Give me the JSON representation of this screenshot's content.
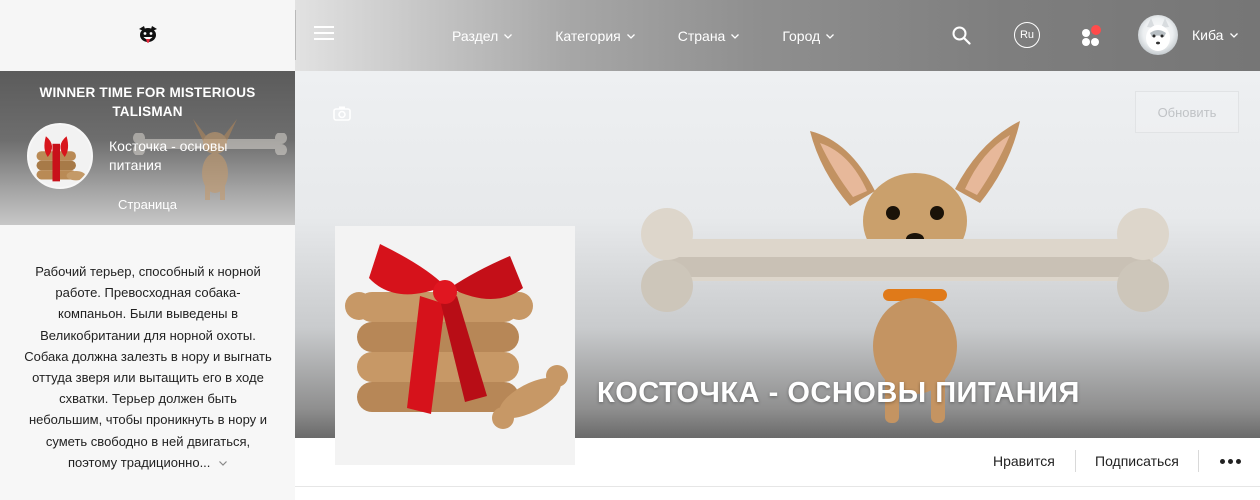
{
  "header": {
    "nav": [
      {
        "label": "Раздел"
      },
      {
        "label": "Категория"
      },
      {
        "label": "Страна"
      },
      {
        "label": "Город"
      }
    ],
    "lang": "Ru",
    "user_name": "Киба",
    "notification_color": "#ff4b4b"
  },
  "sidebar": {
    "card_title": "WINNER TIME FOR MISTERIOUS TALISMAN",
    "page_name": "Косточка - основы питания",
    "page_type": "Страница",
    "description": "Рабочий терьер, способный к норной работе. Превосходная собака-компаньон. Были выведены в Великобритании для норной охоты. Собака должна залезть в нору и выгнать оттуда зверя или вытащить его в ходе схватки. Терьер должен быть небольшим, чтобы проникнуть в нору и суметь свободно в ней двигаться, поэтому традиционно..."
  },
  "cover": {
    "title": "КОСТОЧКА - ОСНОВЫ ПИТАНИЯ",
    "update_label": "Обновить"
  },
  "actions": {
    "like_label": "Нравится",
    "subscribe_label": "Подписаться"
  }
}
